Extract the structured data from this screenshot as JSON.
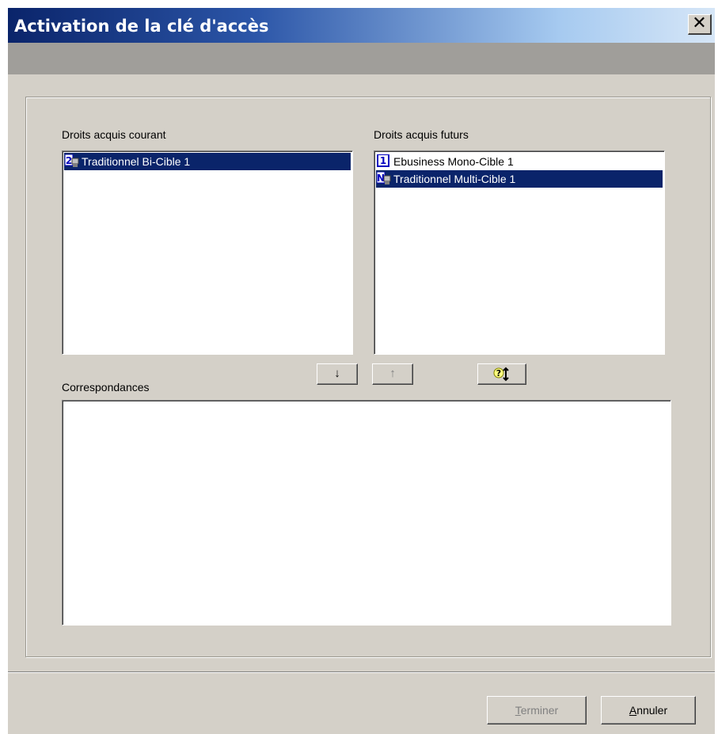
{
  "window": {
    "title": "Activation de la clé d'accès",
    "close_glyph": "✕"
  },
  "current_rights": {
    "label": "Droits acquis courant",
    "items": [
      {
        "label": "Traditionnel Bi-Cible 1",
        "icon": "bi-cible-icon",
        "badge": "2",
        "selected": true
      }
    ]
  },
  "future_rights": {
    "label": "Droits acquis futurs",
    "items": [
      {
        "label": "Ebusiness Mono-Cible 1",
        "icon": "mono-cible-icon",
        "badge": "1",
        "selected": false
      },
      {
        "label": "Traditionnel Multi-Cible 1",
        "icon": "multi-cible-icon",
        "badge": "N",
        "selected": true
      }
    ]
  },
  "transfer": {
    "down_glyph": "↓",
    "up_glyph": "↑",
    "auto_icon": "auto-match-icon",
    "auto_badge": "?"
  },
  "correspondences": {
    "label": "Correspondances",
    "items": []
  },
  "footer": {
    "finish": {
      "label": "Terminer",
      "mnemonic": "T",
      "rest": "erminer",
      "enabled": false
    },
    "cancel": {
      "label": "Annuler",
      "mnemonic": "A",
      "rest": "nnuler",
      "enabled": true
    }
  },
  "colors": {
    "selection": "#0a246a",
    "face": "#d4d0c8",
    "title_start": "#0a246a",
    "title_end": "#d6e6f7"
  }
}
